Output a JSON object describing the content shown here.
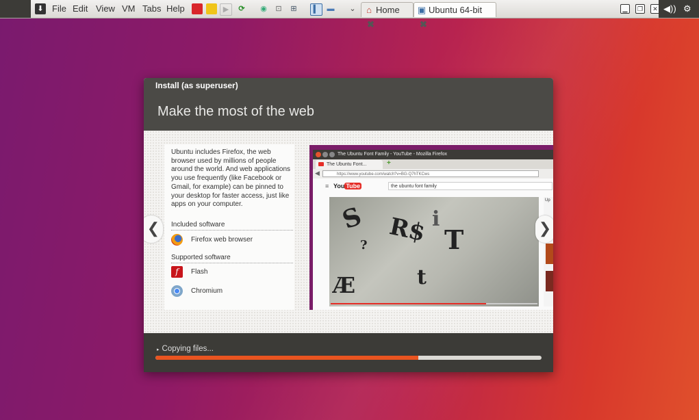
{
  "vm_menu": [
    "File",
    "Edit",
    "View",
    "VM",
    "Tabs",
    "Help"
  ],
  "vm_tabs": [
    {
      "label": "Home",
      "icon": "home-icon"
    },
    {
      "label": "Ubuntu 64-bit",
      "icon": "vm-icon"
    }
  ],
  "installer": {
    "window_title": "Install (as superuser)",
    "heading": "Make the most of the web",
    "description": "Ubuntu includes Firefox, the web browser used by millions of people around the world. And web applications you use frequently (like Facebook or Gmail, for example) can be pinned to your desktop for faster access, just like apps on your computer.",
    "included_title": "Included software",
    "included": [
      {
        "label": "Firefox web browser",
        "icon": "firefox-icon"
      }
    ],
    "supported_title": "Supported software",
    "supported": [
      {
        "label": "Flash",
        "icon": "flash-icon"
      },
      {
        "label": "Chromium",
        "icon": "chromium-icon"
      }
    ],
    "prev_glyph": "❮",
    "next_glyph": "❯",
    "status_text": "Copying files...",
    "progress_fraction": 0.68
  },
  "screenshot": {
    "window_title": "The Ubuntu Font Family - YouTube - Mozilla Firefox",
    "tab_label": "The Ubuntu Font...",
    "url": "https://www.youtube.com/watch?v=BG-Q7hTKCws",
    "search_text": "the ubuntu font family",
    "logo_you": "You",
    "logo_tube": "Tube",
    "side_label": "Up"
  },
  "colors": {
    "accent": "#e95420",
    "dark": "#3c3b37"
  }
}
